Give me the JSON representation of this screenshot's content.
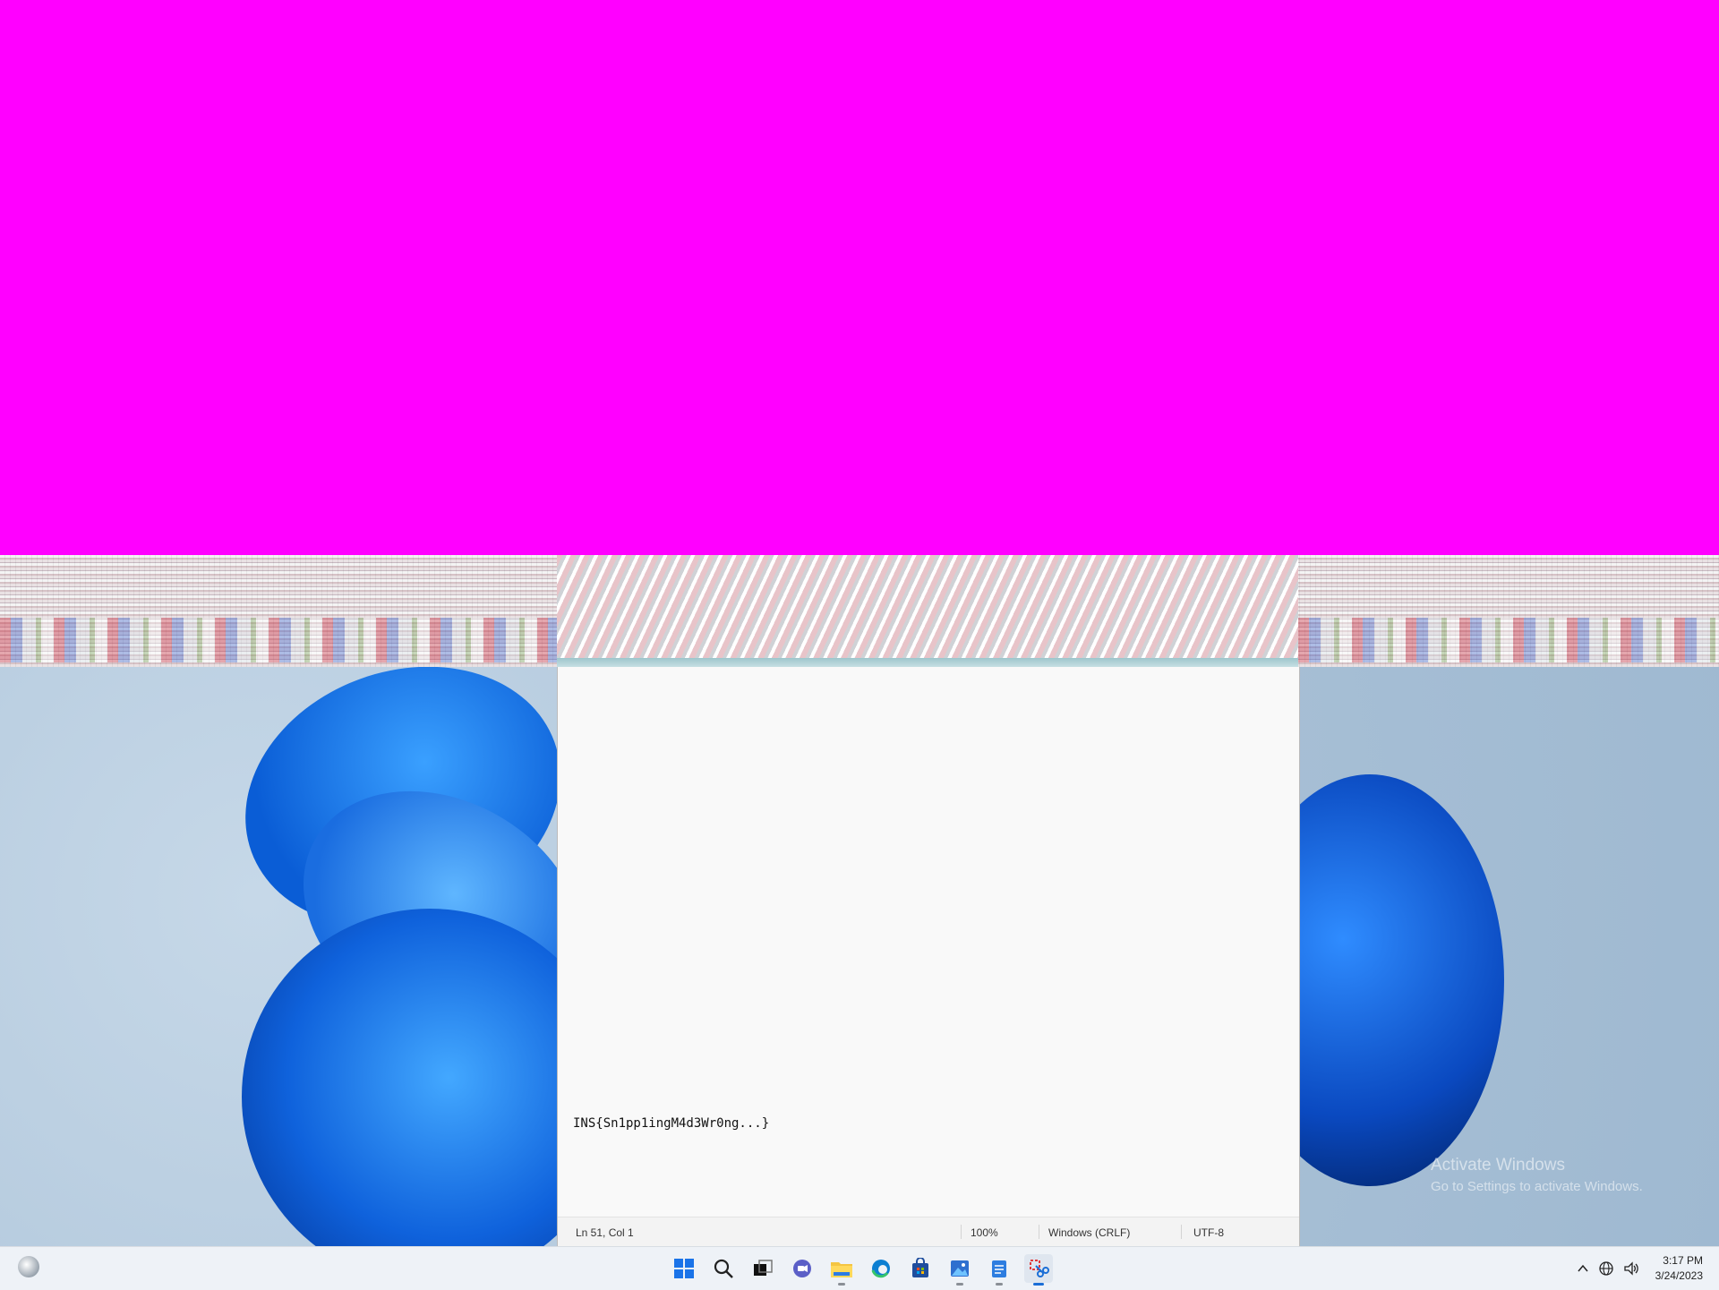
{
  "desktop": {
    "watermark_title": "Activate Windows",
    "watermark_subtitle": "Go to Settings to activate Windows."
  },
  "notepad": {
    "content_line": "INS{Sn1pp1ingM4d3Wr0ng...}",
    "status": {
      "position": "Ln 51, Col 1",
      "zoom": "100%",
      "line_ending": "Windows (CRLF)",
      "encoding": "UTF-8"
    }
  },
  "taskbar": {
    "icons": [
      {
        "name": "start"
      },
      {
        "name": "search"
      },
      {
        "name": "task-view"
      },
      {
        "name": "chat"
      },
      {
        "name": "file-explorer"
      },
      {
        "name": "edge"
      },
      {
        "name": "store"
      },
      {
        "name": "photos"
      },
      {
        "name": "notepad"
      },
      {
        "name": "snipping-tool"
      }
    ],
    "time": "3:17 PM",
    "date": "3/24/2023"
  },
  "colors": {
    "corruption": "#ff00ff",
    "accent": "#1b6ed6"
  }
}
